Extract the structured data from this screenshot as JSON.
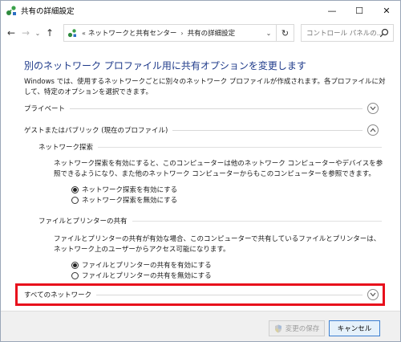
{
  "window": {
    "title": "共有の詳細設定",
    "controls": {
      "minimize": "—",
      "maximize": "☐",
      "close": "✕"
    }
  },
  "nav": {
    "back": "←",
    "forward": "→",
    "history": "⌄",
    "up": "↑",
    "address": {
      "overflow": "«",
      "crumbs": [
        "ネットワークと共有センター",
        "共有の詳細設定"
      ],
      "separator": "›",
      "dropdown": "⌄"
    },
    "refresh": "↻",
    "search": {
      "placeholder": "コントロール パネルの..."
    }
  },
  "main": {
    "title": "別のネットワーク プロファイル用に共有オプションを変更します",
    "intro": "Windows では、使用するネットワークごとに別々のネットワーク プロファイルが作成されます。各プロファイルに対して、特定のオプションを選択できます。",
    "sections": {
      "private": {
        "label": "プライベート",
        "state": "collapsed"
      },
      "guest": {
        "label": "ゲストまたはパブリック (現在のプロファイル)",
        "state": "expanded",
        "discovery": {
          "heading": "ネットワーク探索",
          "description": "ネットワーク探索を有効にすると、このコンピューターは他のネットワーク コンピューターやデバイスを参照できるようになり、また他のネットワーク コンピューターからもこのコンピューターを参照できます。",
          "options": [
            {
              "label": "ネットワーク探索を有効にする",
              "selected": true
            },
            {
              "label": "ネットワーク探索を無効にする",
              "selected": false
            }
          ]
        },
        "sharing": {
          "heading": "ファイルとプリンターの共有",
          "description": "ファイルとプリンターの共有が有効な場合、このコンピューターで共有しているファイルとプリンターは、ネットワーク上のユーザーからアクセス可能になります。",
          "options": [
            {
              "label": "ファイルとプリンターの共有を有効にする",
              "selected": true
            },
            {
              "label": "ファイルとプリンターの共有を無効にする",
              "selected": false
            }
          ]
        }
      },
      "all": {
        "label": "すべてのネットワーク",
        "state": "collapsed"
      }
    }
  },
  "footer": {
    "save_label": "変更の保存",
    "cancel_label": "キャンセル"
  },
  "colors": {
    "title_blue": "#1e3a8a",
    "highlight_red": "#e8101c",
    "network_icon_green": "#2e8b3e"
  }
}
